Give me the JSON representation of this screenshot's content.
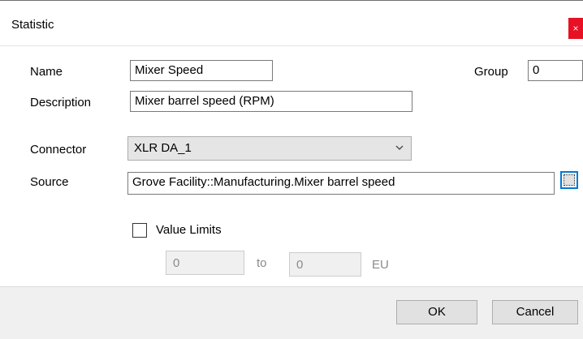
{
  "window": {
    "title": "Statistic",
    "close_glyph": "×"
  },
  "form": {
    "name": {
      "label": "Name",
      "value": "Mixer Speed"
    },
    "group": {
      "label": "Group",
      "value": "0"
    },
    "description": {
      "label": "Description",
      "value": "Mixer barrel speed (RPM)"
    },
    "connector": {
      "label": "Connector",
      "value": "XLR DA_1"
    },
    "source": {
      "label": "Source",
      "value": "Grove Facility::Manufacturing.Mixer barrel speed"
    },
    "value_limits": {
      "label": "Value Limits",
      "checked": false,
      "min": "0",
      "to_label": "to",
      "max": "0",
      "unit": "EU"
    }
  },
  "buttons": {
    "ok": "OK",
    "cancel": "Cancel"
  }
}
